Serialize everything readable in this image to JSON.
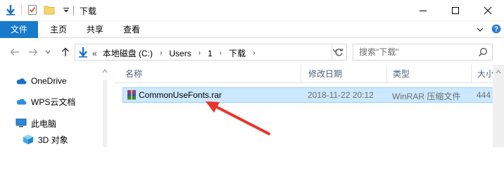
{
  "window": {
    "title": "下载"
  },
  "ribbon": {
    "tabs": [
      {
        "label": "文件"
      },
      {
        "label": "主页"
      },
      {
        "label": "共享"
      },
      {
        "label": "查看"
      }
    ]
  },
  "address": {
    "crumbs": [
      "本地磁盘 (C:)",
      "Users",
      "1",
      "下载"
    ],
    "overflow": "«"
  },
  "search": {
    "placeholder": "搜索\"下载\""
  },
  "nav": {
    "items": [
      {
        "label": "OneDrive",
        "icon": "cloud-icon"
      },
      {
        "label": "WPS云文档",
        "icon": "cloud-icon"
      },
      {
        "label": "此电脑",
        "icon": "computer-icon"
      },
      {
        "label": "3D 对象",
        "icon": "cube-icon"
      }
    ]
  },
  "columns": {
    "name": "名称",
    "modified": "修改日期",
    "type": "类型",
    "size": "大小"
  },
  "files": [
    {
      "name": "CommonUseFonts.rar",
      "modified": "2018-11-22 20:12",
      "type": "WinRAR 压缩文件",
      "size": "444",
      "icon": "winrar-archive-icon",
      "selected": true
    }
  ],
  "annotation": {
    "color": "#e8352b",
    "icon": "red-arrow-pointer"
  }
}
